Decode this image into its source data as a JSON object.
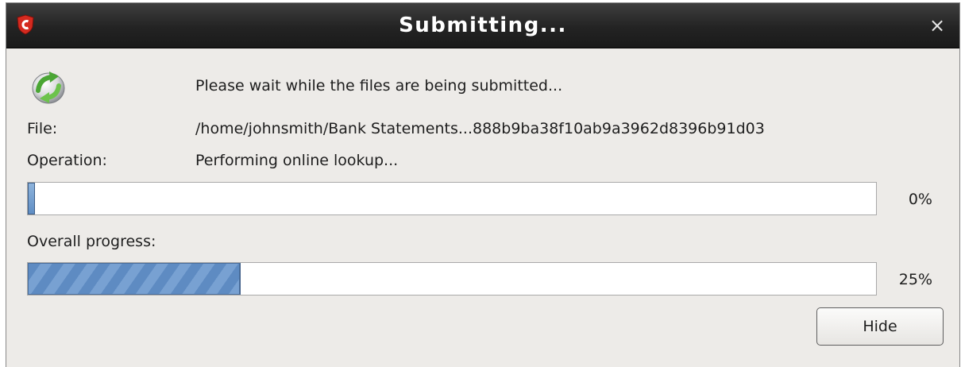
{
  "window": {
    "title": "Submitting...",
    "close_label": "×"
  },
  "status": {
    "message": "Please wait while the files are being submitted...",
    "icon": "refresh-sync-icon"
  },
  "details": {
    "file_label": "File:",
    "file_value": "/home/johnsmith/Bank Statements...888b9ba38f10ab9a3962d8396b91d03",
    "operation_label": "Operation:",
    "operation_value": "Performing online lookup..."
  },
  "file_progress": {
    "value": 0,
    "text": "0%"
  },
  "overall_progress": {
    "label": "Overall progress:",
    "value": 25,
    "text": "25%"
  },
  "buttons": {
    "hide_label": "Hide"
  },
  "colors": {
    "titlebar": "#232323",
    "window_bg": "#edebe8",
    "progress_fill": "#6f98cc",
    "app_icon": "#d42a1f"
  }
}
